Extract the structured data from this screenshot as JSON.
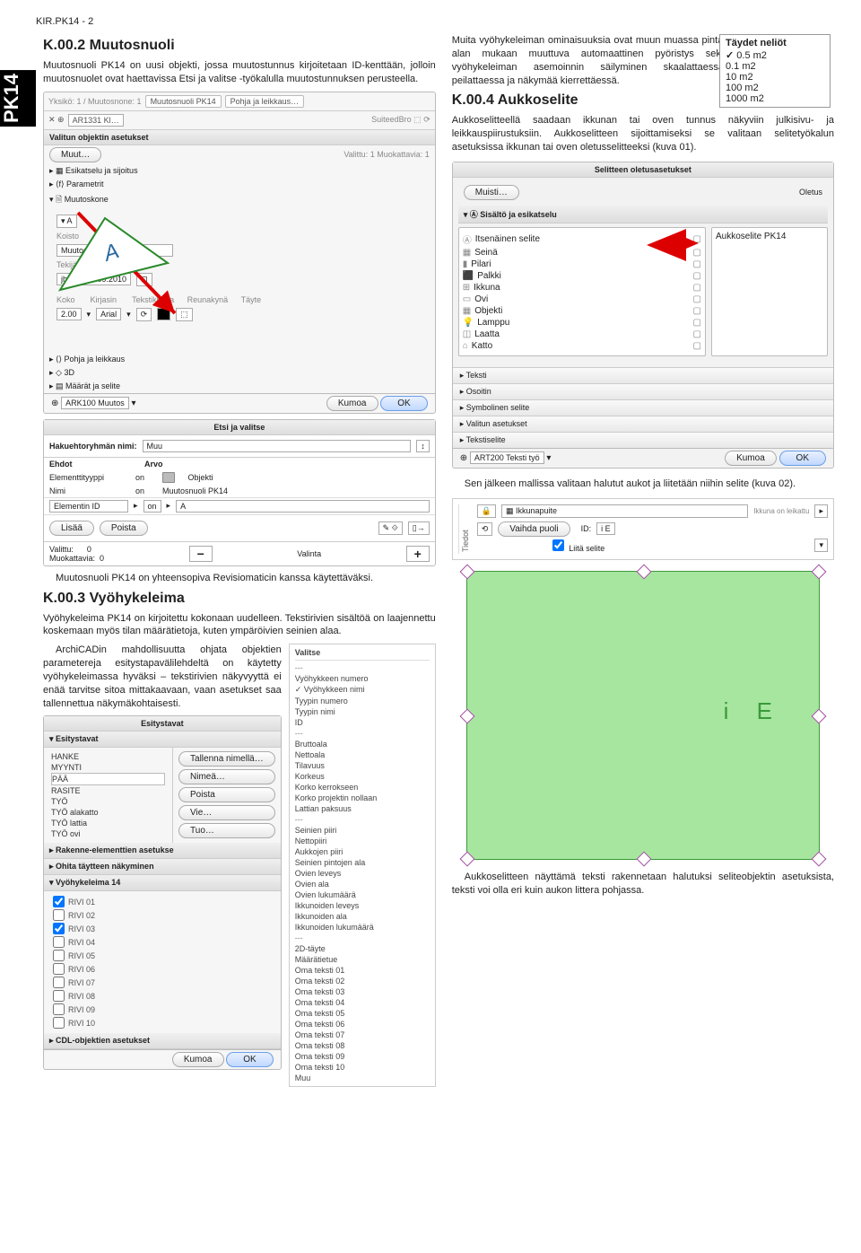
{
  "header": "KIR.PK14 - 2",
  "tab": "PK14",
  "s1": {
    "title": "K.00.2 Muutosnuoli",
    "p1": "Muutosnuoli PK14 on uusi objekti, jossa muutostunnus kirjoitetaan ID-kenttään, jolloin muutosnuolet ovat haettavissa Etsi ja valitse -työkalulla muutostunnuksen perusteella."
  },
  "top_panel": {
    "title": "Muutosnuoli PK14",
    "btn1": "Pohja ja leikkaus…",
    "chip": "AR1331 Kl…",
    "sec_hdr": "Valitun objektin asetukset",
    "valittu": "Valittu: 1 Muokattavia: 1",
    "muut_btn": "Muut…",
    "g1": "Esikatselu ja sijoitus",
    "g2": "Parametrit",
    "g3": "Muutoskone",
    "lbl_koisto": "Koisto",
    "koisto_val": "Muutostunnus",
    "lbl_tekija": "Tekijä",
    "tekija_val": "jhh",
    "lbl_paivays": "Päiväys",
    "paivays_val": "14.09.2010",
    "koko": "Koko",
    "koko_val": "2.00",
    "kirjasin": "Kirjasin",
    "kirjasin_val": "Arial",
    "txtkulma": "Tekstikulma",
    "reuna": "Reunakynä",
    "tayte": "Täyte",
    "h1": "Pohja ja leikkaus",
    "h2": "3D",
    "h3": "Määrät ja selite",
    "foot_layer": "ARK100 Muutos",
    "kumoa": "Kumoa",
    "ok": "OK"
  },
  "etsi": {
    "title": "Etsi ja valitse",
    "hak": "Hakuehtoryhmän nimi:",
    "hak_val": "Muu",
    "col1": "Ehdot",
    "col2": "Arvo",
    "r1a": "Elementtityyppi",
    "r1b": "on",
    "r1c": "Objekti",
    "r2a": "Nimi",
    "r2b": "on",
    "r2c": "Muutosnuoli PK14",
    "r3a": "Elementin ID",
    "r3b": "on",
    "r3c": "A",
    "lisaa": "Lisää",
    "poista": "Poista",
    "valittu": "Valittu:",
    "valittu_n": "0",
    "muok": "Muokattavia:",
    "muok_n": "0",
    "valinta": "Valinta"
  },
  "after_etsi": "Muutosnuoli PK14 on yhteensopiva Revisiomaticin kanssa käytettäväksi.",
  "s3": {
    "title": "K.00.3 Vyöhykeleima",
    "p1": "Vyöhykeleima PK14 on kirjoitettu kokonaan uudelleen. Tekstirivien sisältöä on laajennettu koskemaan myös tilan määrätietoja, kuten ympäröivien seinien alaa.",
    "p2": "ArchiCADin mahdollisuutta ohjata objektien parametereja esitystapavälilehdeltä on käytetty vyöhykeleimassa hyväksi – tekstirivien näkyvyyttä ei enää tarvitse sitoa mittakaavaan, vaan asetukset saa tallennettua näkymäkohtaisesti."
  },
  "esity": {
    "title": "Esitystavat",
    "hdr": "Esitystavat",
    "save": "Tallenna nimellä…",
    "nimea": "Nimeä…",
    "poista": "Poista",
    "vie": "Vie…",
    "tuo": "Tuo…",
    "items": [
      "HANKE",
      "MYYNTI",
      "PÄÄ",
      "RASITE",
      "TYÖ",
      "TYÖ alakatto",
      "TYÖ lattia",
      "TYÖ ovi"
    ],
    "g1": "Rakenne-elementtien asetukse",
    "g2": "Ohita täytteen näkyminen",
    "g3": "Vyöhykeleima 14",
    "cb": [
      "RIVI 01",
      "RIVI 02",
      "RIVI 03",
      "RIVI 04",
      "RIVI 05",
      "RIVI 06",
      "RIVI 07",
      "RIVI 08",
      "RIVI 09",
      "RIVI 10"
    ],
    "cb_on": [
      0,
      2
    ],
    "cdl": "CDL-objektien asetukset",
    "kumoa": "Kumoa",
    "ok": "OK"
  },
  "valitse": {
    "title": "Valitse",
    "items1": [
      "Vyöhykkeen numero",
      "Vyöhykkeen nimi",
      "Tyypin numero",
      "Tyypin nimi",
      "ID"
    ],
    "checked": 1,
    "items2": [
      "Bruttoala",
      "Nettoala",
      "Tilavuus",
      "Korkeus",
      "Korko kerrokseen",
      "Korko projektin nollaan",
      "Lattian paksuus"
    ],
    "items3": [
      "Seinien piiri",
      "Nettopiiri",
      "Aukkojen piiri",
      "Seinien pintojen ala",
      "Ovien leveys",
      "Ovien ala",
      "Ovien lukumäärä",
      "Ikkunoiden leveys",
      "Ikkunoiden ala",
      "Ikkunoiden lukumäärä"
    ],
    "items4": [
      "2D-täyte",
      "Määrätietue",
      "Oma teksti 01",
      "Oma teksti 02",
      "Oma teksti 03",
      "Oma teksti 04",
      "Oma teksti 05",
      "Oma teksti 06",
      "Oma teksti 07",
      "Oma teksti 08",
      "Oma teksti 09",
      "Oma teksti 10",
      "Muu"
    ]
  },
  "right_intro": "Muita vyöhykeleiman ominaisuuksia ovat muun muassa pinta-alan mukaan muuttuva automaattinen pyöristys sekä vyöhykeleiman asemoinnin säilyminen skaalattaessa, peilattaessa ja näkymää kierrettäessä.",
  "neliot": {
    "hdr": "Täydet neliöt",
    "items": [
      "0.5 m2",
      "0.1 m2",
      "10 m2",
      "100 m2",
      "1000 m2"
    ],
    "sel": 0
  },
  "s4": {
    "title": "K.00.4 Aukkoselite",
    "p1": "Aukkoselitteellä saadaan ikkunan tai oven tunnus näkyviin julkisivu- ja leikkauspiirustuksiin. Aukkoselitteen sijoittamiseksi se valitaan selitetyökalun asetuksissa ikkunan tai oven oletusselitteeksi (kuva 01)."
  },
  "selit": {
    "title": "Selitteen oletusasetukset",
    "muisti": "Muisti…",
    "oletus": "Oletus",
    "grp": "Sisältö ja esikatselu",
    "tree": [
      "Itsenäinen selite",
      "Seinä",
      "Pilari",
      "Palkki",
      "Ikkuna",
      "Ovi",
      "Objekti",
      "Lamppu",
      "Laatta",
      "Katto"
    ],
    "side": "Aukkoselite PK14",
    "sl": [
      "Teksti",
      "Osoitin",
      "Symbolinen selite",
      "Valitun asetukset",
      "Tekstiselite"
    ],
    "layer": "ART200 Teksti työ",
    "kumoa": "Kumoa",
    "ok": "OK"
  },
  "after_selit": "Sen jälkeen mallissa valitaan halutut aukot ja liitetään niihin selite (kuva 02).",
  "tiedot": {
    "side": "Tiedot",
    "obj": "Ikkunapuite",
    "corner": "Ikkuna on leikattu",
    "vaihda": "Vaihda puoli",
    "id_lbl": "ID:",
    "id": "i E",
    "liita": "Liitä selite",
    "center": "i E"
  },
  "final": "Aukkoselitteen näyttämä teksti rakennetaan halutuksi seliteobjektin asetuksista, teksti voi olla eri kuin aukon littera pohjassa."
}
